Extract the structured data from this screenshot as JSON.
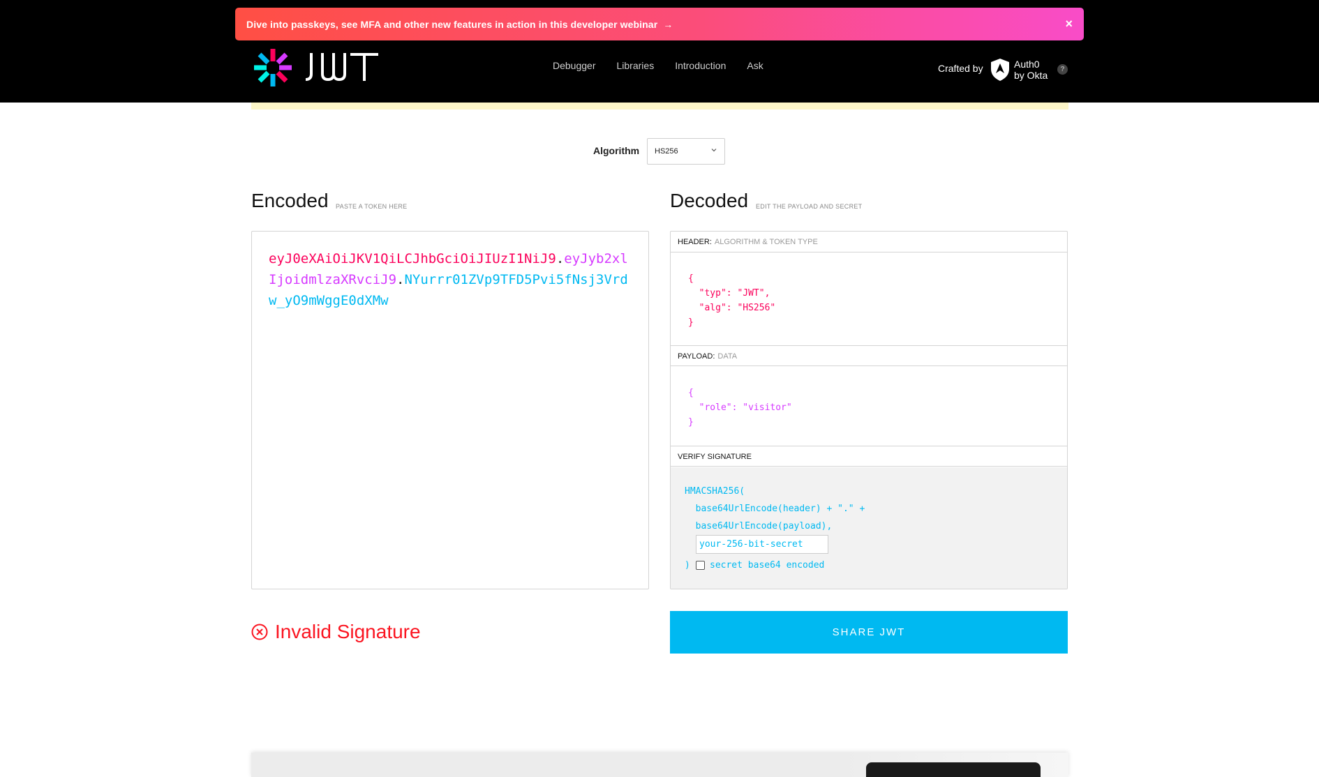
{
  "banner": {
    "text": "Dive into passkeys, see MFA and other new features in action in this developer webinar",
    "arrow": "→",
    "close": "×"
  },
  "header": {
    "nav": [
      "Debugger",
      "Libraries",
      "Introduction",
      "Ask"
    ],
    "crafted_by": "Crafted by",
    "partner_line1": "Auth0",
    "partner_line2": "by Okta",
    "help": "?"
  },
  "algorithm": {
    "label": "Algorithm",
    "selected": "HS256"
  },
  "encoded": {
    "title": "Encoded",
    "subtitle": "PASTE A TOKEN HERE",
    "header_part": "eyJ0eXAiOiJKV1QiLCJhbGciOiJIUzI1NiJ9",
    "payload_part": "eyJyb2xlIjoidmlzaXRvciJ9",
    "signature_part": "NYurrr01ZVp9TFD5Pvi5fNsj3Vrdw_yO9mWggE0dXMw",
    "dot": "."
  },
  "decoded": {
    "title": "Decoded",
    "subtitle": "EDIT THE PAYLOAD AND SECRET",
    "header_label": "HEADER:",
    "header_desc": "ALGORITHM & TOKEN TYPE",
    "header_json": "{\n  \"typ\": \"JWT\",\n  \"alg\": \"HS256\"\n}",
    "payload_label": "PAYLOAD:",
    "payload_desc": "DATA",
    "payload_json": "{\n  \"role\": \"visitor\"\n}",
    "verify_label": "VERIFY SIGNATURE",
    "sig_line1": "HMACSHA256(",
    "sig_line2": "  base64UrlEncode(header) + \".\" +",
    "sig_line3": "  base64UrlEncode(payload),",
    "secret_placeholder": "your-256-bit-secret",
    "close_paren": ")",
    "base64_label": "secret base64 encoded"
  },
  "status": {
    "text": "Invalid Signature",
    "color": "#fb1420"
  },
  "share_button": "SHARE JWT",
  "colors": {
    "header": "#fb015b",
    "payload": "#d63aff",
    "signature": "#00b9f1"
  }
}
